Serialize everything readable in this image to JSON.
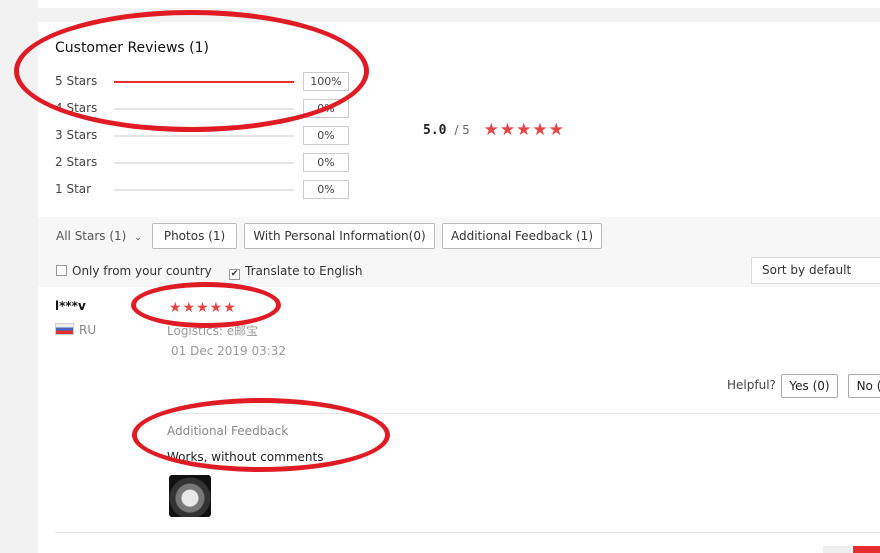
{
  "reviews": {
    "title": "Customer Reviews (1)",
    "breakdown": [
      {
        "label": "5 Stars",
        "percent": "100%",
        "fill": 1.0
      },
      {
        "label": "4 Stars",
        "percent": "0%",
        "fill": 0
      },
      {
        "label": "3 Stars",
        "percent": "0%",
        "fill": 0
      },
      {
        "label": "2 Stars",
        "percent": "0%",
        "fill": 0
      },
      {
        "label": "1 Star",
        "percent": "0%",
        "fill": 0
      }
    ],
    "average": {
      "score": "5.0",
      "out_of": "/ 5",
      "stars": "★★★★★"
    }
  },
  "filters": {
    "all_stars": "All Stars (1)",
    "photos": "Photos (1)",
    "personal_info": "With Personal Information(0)",
    "additional_feedback": "Additional Feedback (1)",
    "only_country": "Only from your country",
    "translate": "Translate to English",
    "sort": "Sort by default"
  },
  "review": {
    "reviewer": "l***v",
    "country": "RU",
    "stars": "★★★★★",
    "logistics": "Logistics: e邮宝",
    "date": "01 Dec 2019 03:32",
    "helpful_label": "Helpful?",
    "yes": "Yes (0)",
    "no": "No (",
    "feedback_title": "Additional Feedback",
    "feedback_text": "Works, without comments"
  },
  "colors": {
    "accent": "#e62e2e",
    "star": "#e64545",
    "annotation": "#e01b24"
  }
}
